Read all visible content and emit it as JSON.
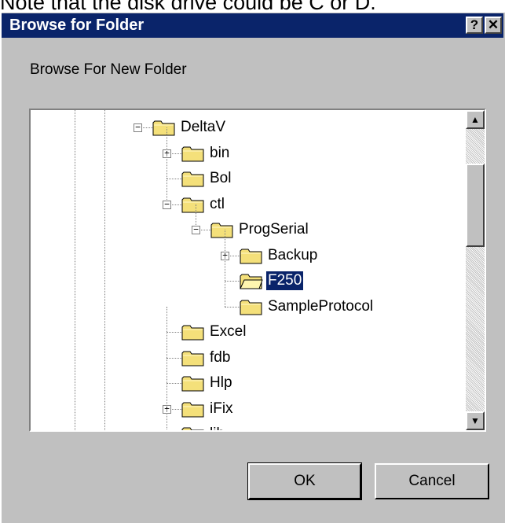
{
  "note_text": "Note that the disk drive could be C or D.",
  "dialog": {
    "title": "Browse for Folder",
    "help_label": "?",
    "close_label": "✕",
    "prompt": "Browse For New Folder",
    "ok_label": "OK",
    "cancel_label": "Cancel"
  },
  "tree": {
    "items": [
      {
        "label": "DeltaV",
        "expander": "−",
        "selected": false
      },
      {
        "label": "bin",
        "expander": "+",
        "selected": false
      },
      {
        "label": "Bol",
        "expander": "",
        "selected": false
      },
      {
        "label": "ctl",
        "expander": "−",
        "selected": false
      },
      {
        "label": "ProgSerial",
        "expander": "−",
        "selected": false
      },
      {
        "label": "Backup",
        "expander": "+",
        "selected": false
      },
      {
        "label": "F250",
        "expander": "",
        "selected": true
      },
      {
        "label": "SampleProtocol",
        "expander": "",
        "selected": false
      },
      {
        "label": "Excel",
        "expander": "",
        "selected": false
      },
      {
        "label": "fdb",
        "expander": "",
        "selected": false
      },
      {
        "label": "Hlp",
        "expander": "",
        "selected": false
      },
      {
        "label": "iFix",
        "expander": "+",
        "selected": false
      },
      {
        "label": "lib",
        "expander": "",
        "selected": false
      }
    ]
  },
  "scrollbar": {
    "up_icon": "▲",
    "down_icon": "▼"
  },
  "colors": {
    "titlebar": "#0a246a",
    "selection": "#0a246a",
    "face": "#c0c0c0",
    "folder": "#f4e07a"
  }
}
